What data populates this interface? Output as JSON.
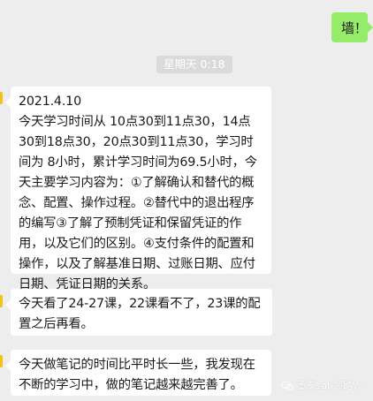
{
  "chat": {
    "messages": [
      {
        "direction": "out",
        "text": "墙！"
      },
      {
        "direction": "in",
        "text": "2021.4.10\n今天学习时间从  10点30到11点30，14点30到18点30，20点30到11点30，学习时间为  8小时，累计学习时间为69.5小时，今天主要学习内容为：①了解确认和替代的概念、配置、操作过程。②替代中的退出程序的编写③了解了预制凭证和保留凭证的作用，以及它们的区别。④支付条件的配置和操作，以及了解基准日期、过账日期、应付日期、凭证日期的关系。"
      },
      {
        "direction": "in",
        "text": "今天看了24-27课，22课看不了，23课的配置之后再看。"
      },
      {
        "direction": "in",
        "text": "今天做笔记的时间比平时长一些，我发现在不断的学习中，做的笔记越来越完善了。"
      }
    ],
    "timestamp": "星期天 0:18"
  },
  "watermark": {
    "text": "董泰sap领路人",
    "icon": "wechat-official-account-icon"
  }
}
